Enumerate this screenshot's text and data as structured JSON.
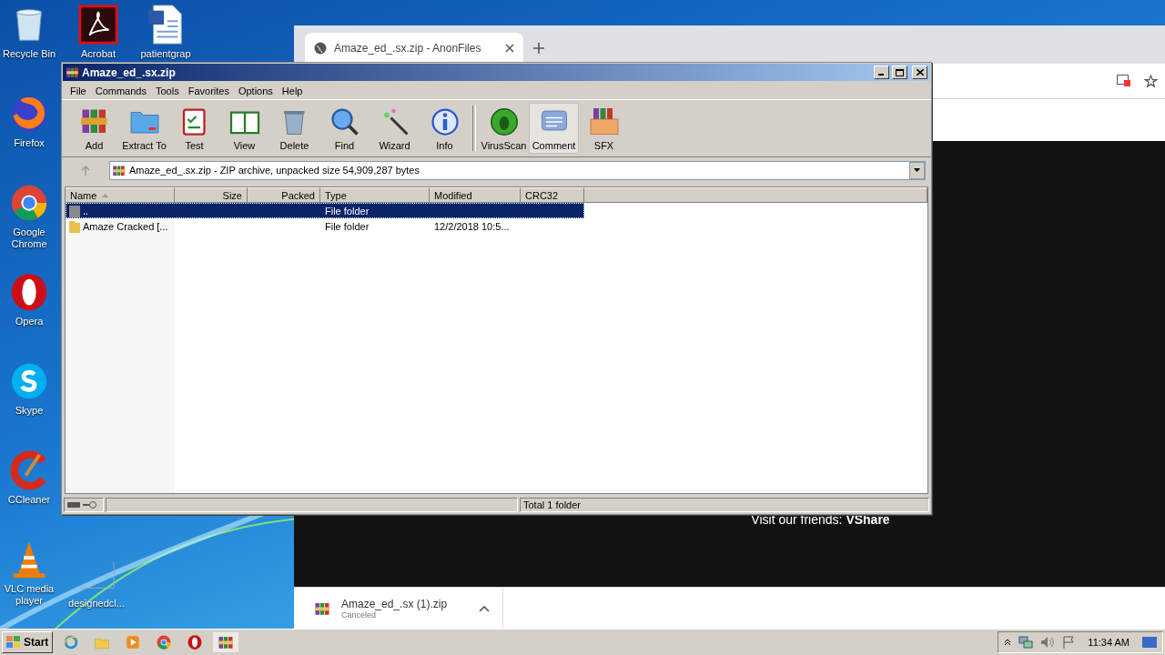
{
  "desktop_icons": [
    {
      "label": "Recycle Bin",
      "kind": "recycle"
    },
    {
      "label": "Acrobat",
      "kind": "acrobat"
    },
    {
      "label": "patientgrap",
      "kind": "word"
    },
    {
      "label": "Firefox",
      "kind": "firefox"
    },
    {
      "label": "Google Chrome",
      "kind": "chrome"
    },
    {
      "label": "Opera",
      "kind": "opera"
    },
    {
      "label": "Skype",
      "kind": "skype"
    },
    {
      "label": "CCleaner",
      "kind": "ccleaner"
    },
    {
      "label": "VLC media player",
      "kind": "vlc"
    },
    {
      "label": "designedcl...",
      "kind": "blank"
    }
  ],
  "browser": {
    "tab_title": "Amaze_ed_.sx.zip - AnonFiles",
    "promo": "Visit our friends: **VShare**",
    "download": {
      "file": "Amaze_ed_.sx (1).zip",
      "status": "Canceled"
    }
  },
  "winrar": {
    "title": "Amaze_ed_.sx.zip",
    "menu": [
      "File",
      "Commands",
      "Tools",
      "Favorites",
      "Options",
      "Help"
    ],
    "toolbar": [
      {
        "label": "Add",
        "kind": "add",
        "selected": false
      },
      {
        "label": "Extract To",
        "kind": "extract",
        "selected": false
      },
      {
        "label": "Test",
        "kind": "test",
        "selected": false
      },
      {
        "label": "View",
        "kind": "view",
        "selected": false
      },
      {
        "label": "Delete",
        "kind": "delete",
        "selected": false
      },
      {
        "label": "Find",
        "kind": "find",
        "selected": false
      },
      {
        "label": "Wizard",
        "kind": "wizard",
        "selected": false
      },
      {
        "label": "Info",
        "kind": "info",
        "selected": false
      },
      {
        "label": "VirusScan",
        "kind": "virus",
        "selected": false
      },
      {
        "label": "Comment",
        "kind": "comment",
        "selected": true
      },
      {
        "label": "SFX",
        "kind": "sfx",
        "selected": false
      }
    ],
    "path": "Amaze_ed_.sx.zip - ZIP archive, unpacked size 54,909,287 bytes",
    "columns": [
      {
        "label": "Name",
        "sorted": true
      },
      {
        "label": "Size",
        "sorted": false
      },
      {
        "label": "Packed",
        "sorted": false
      },
      {
        "label": "Type",
        "sorted": false
      },
      {
        "label": "Modified",
        "sorted": false
      },
      {
        "label": "CRC32",
        "sorted": false
      }
    ],
    "rows": [
      {
        "kind": "up",
        "name": "..",
        "type": "File folder",
        "selected": true
      },
      {
        "kind": "folder",
        "name": "Amaze Cracked [...",
        "type": "File folder",
        "modified": "12/2/2018 10:5...",
        "selected": false
      }
    ],
    "status": "Total 1 folder"
  },
  "taskbar": {
    "start": "Start",
    "apps": [
      {
        "kind": "ie",
        "selected": false
      },
      {
        "kind": "explorer",
        "selected": false
      },
      {
        "kind": "media",
        "selected": false
      },
      {
        "kind": "chrome",
        "selected": false
      },
      {
        "kind": "opera",
        "selected": false
      },
      {
        "kind": "winrar",
        "selected": true
      }
    ],
    "clock": "11:34 AM"
  }
}
